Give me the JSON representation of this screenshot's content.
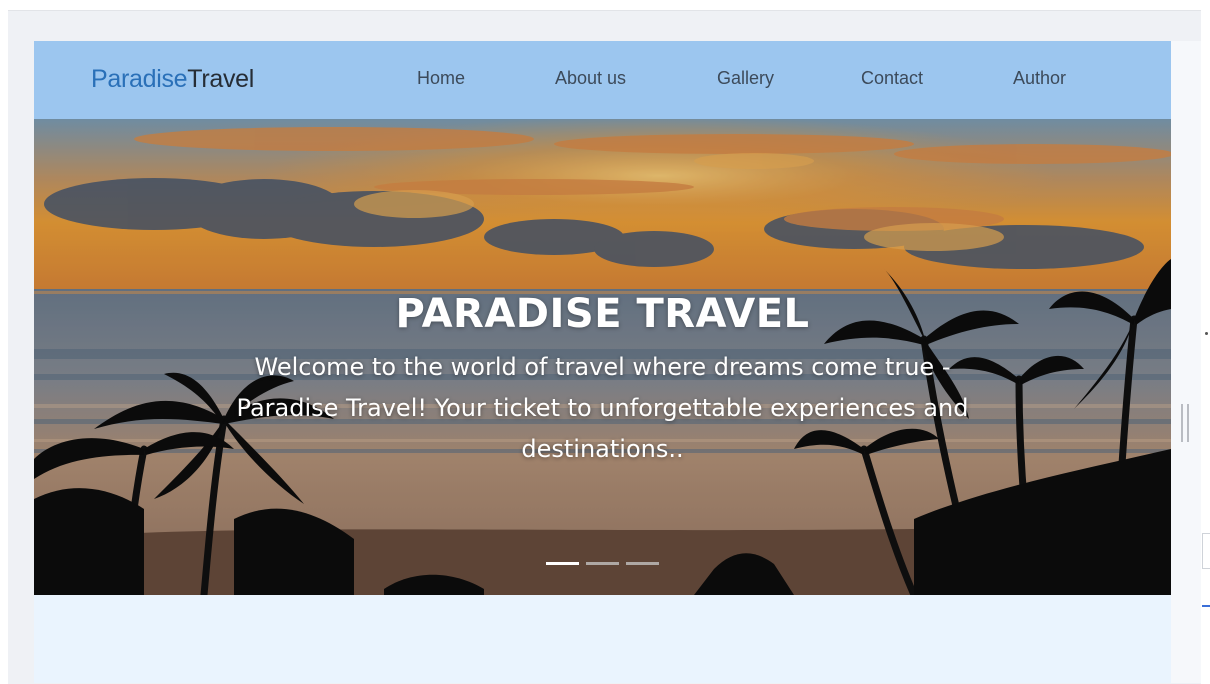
{
  "brand": {
    "part1": "Paradise",
    "part2": "Travel"
  },
  "nav": {
    "items": [
      {
        "label": "Home"
      },
      {
        "label": "About us"
      },
      {
        "label": "Gallery"
      },
      {
        "label": "Contact"
      },
      {
        "label": "Author"
      }
    ]
  },
  "hero": {
    "title": "PARADISE TRAVEL",
    "text": "Welcome to the world of travel where dreams come true - Paradise Travel! Your ticket to unforgettable experiences and destinations..",
    "slides": {
      "count": 3,
      "active": 1
    }
  },
  "colors": {
    "navbar": "#9cc6ef",
    "brand_part1": "#2a70b8",
    "brand_part2": "#262d36",
    "page_background": "#eaf4fe",
    "indicator_active": "#ffffff",
    "indicator_inactive": "#c9c9c9"
  }
}
